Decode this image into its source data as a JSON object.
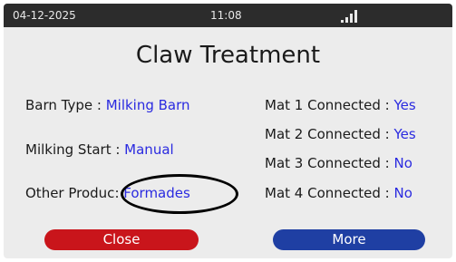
{
  "status_bar": {
    "date": "04-12-2025",
    "time": "11:08",
    "signal_icon": "signal-bars"
  },
  "title": "Claw Treatment",
  "left_fields": [
    {
      "label": "Barn Type",
      "separator": " : ",
      "value": "Milking Barn"
    },
    {
      "label": "Milking Start",
      "separator": " : ",
      "value": "Manual"
    },
    {
      "label": "Other Produc",
      "separator": ": ",
      "value": "Formades"
    }
  ],
  "right_fields": [
    {
      "label": "Mat 1 Connected",
      "separator": " : ",
      "value": "Yes"
    },
    {
      "label": "Mat 2 Connected",
      "separator": " : ",
      "value": "Yes"
    },
    {
      "label": "Mat 3 Connected",
      "separator": " : ",
      "value": "No"
    },
    {
      "label": "Mat 4 Connected",
      "separator": " : ",
      "value": "No"
    }
  ],
  "buttons": {
    "close_label": "Close",
    "more_label": "More"
  },
  "colors": {
    "status_bar_bg": "#2c2c2c",
    "screen_bg": "#ececec",
    "value_text": "#2a2ae0",
    "close_button": "#c9151b",
    "more_button": "#1f3fa3",
    "annotation": "#000000"
  }
}
